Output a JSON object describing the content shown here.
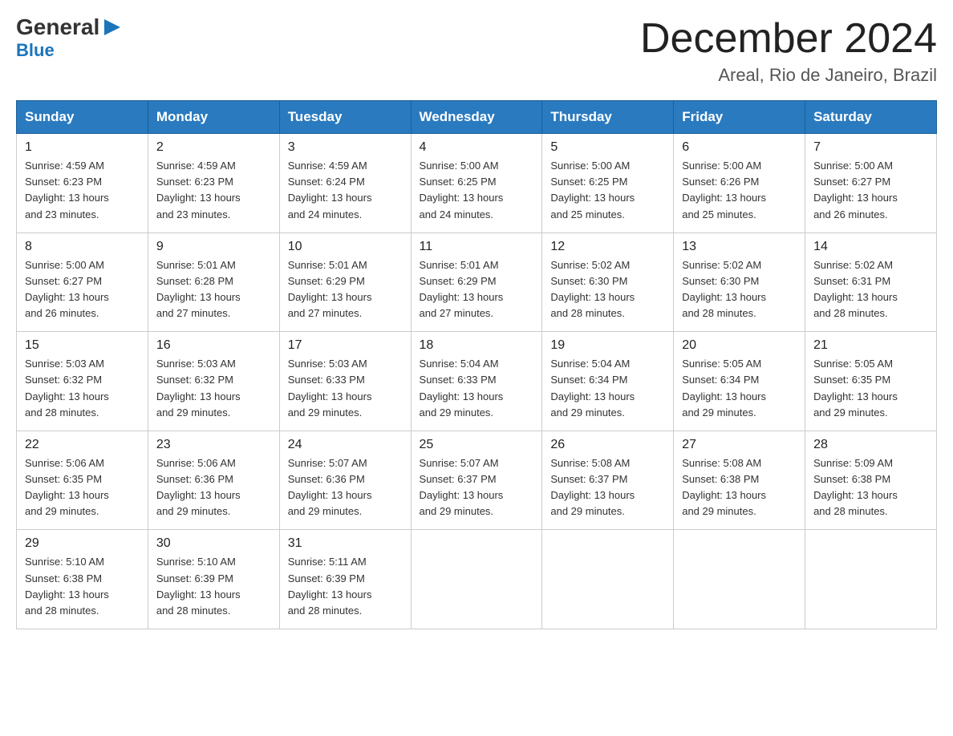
{
  "logo": {
    "general": "General",
    "blue": "Blue",
    "arrow": "▶"
  },
  "title": {
    "main": "December 2024",
    "subtitle": "Areal, Rio de Janeiro, Brazil"
  },
  "header": {
    "days": [
      "Sunday",
      "Monday",
      "Tuesday",
      "Wednesday",
      "Thursday",
      "Friday",
      "Saturday"
    ]
  },
  "weeks": [
    {
      "days": [
        {
          "num": "1",
          "sunrise": "4:59 AM",
          "sunset": "6:23 PM",
          "daylight": "13 hours and 23 minutes."
        },
        {
          "num": "2",
          "sunrise": "4:59 AM",
          "sunset": "6:23 PM",
          "daylight": "13 hours and 23 minutes."
        },
        {
          "num": "3",
          "sunrise": "4:59 AM",
          "sunset": "6:24 PM",
          "daylight": "13 hours and 24 minutes."
        },
        {
          "num": "4",
          "sunrise": "5:00 AM",
          "sunset": "6:25 PM",
          "daylight": "13 hours and 24 minutes."
        },
        {
          "num": "5",
          "sunrise": "5:00 AM",
          "sunset": "6:25 PM",
          "daylight": "13 hours and 25 minutes."
        },
        {
          "num": "6",
          "sunrise": "5:00 AM",
          "sunset": "6:26 PM",
          "daylight": "13 hours and 25 minutes."
        },
        {
          "num": "7",
          "sunrise": "5:00 AM",
          "sunset": "6:27 PM",
          "daylight": "13 hours and 26 minutes."
        }
      ]
    },
    {
      "days": [
        {
          "num": "8",
          "sunrise": "5:00 AM",
          "sunset": "6:27 PM",
          "daylight": "13 hours and 26 minutes."
        },
        {
          "num": "9",
          "sunrise": "5:01 AM",
          "sunset": "6:28 PM",
          "daylight": "13 hours and 27 minutes."
        },
        {
          "num": "10",
          "sunrise": "5:01 AM",
          "sunset": "6:29 PM",
          "daylight": "13 hours and 27 minutes."
        },
        {
          "num": "11",
          "sunrise": "5:01 AM",
          "sunset": "6:29 PM",
          "daylight": "13 hours and 27 minutes."
        },
        {
          "num": "12",
          "sunrise": "5:02 AM",
          "sunset": "6:30 PM",
          "daylight": "13 hours and 28 minutes."
        },
        {
          "num": "13",
          "sunrise": "5:02 AM",
          "sunset": "6:30 PM",
          "daylight": "13 hours and 28 minutes."
        },
        {
          "num": "14",
          "sunrise": "5:02 AM",
          "sunset": "6:31 PM",
          "daylight": "13 hours and 28 minutes."
        }
      ]
    },
    {
      "days": [
        {
          "num": "15",
          "sunrise": "5:03 AM",
          "sunset": "6:32 PM",
          "daylight": "13 hours and 28 minutes."
        },
        {
          "num": "16",
          "sunrise": "5:03 AM",
          "sunset": "6:32 PM",
          "daylight": "13 hours and 29 minutes."
        },
        {
          "num": "17",
          "sunrise": "5:03 AM",
          "sunset": "6:33 PM",
          "daylight": "13 hours and 29 minutes."
        },
        {
          "num": "18",
          "sunrise": "5:04 AM",
          "sunset": "6:33 PM",
          "daylight": "13 hours and 29 minutes."
        },
        {
          "num": "19",
          "sunrise": "5:04 AM",
          "sunset": "6:34 PM",
          "daylight": "13 hours and 29 minutes."
        },
        {
          "num": "20",
          "sunrise": "5:05 AM",
          "sunset": "6:34 PM",
          "daylight": "13 hours and 29 minutes."
        },
        {
          "num": "21",
          "sunrise": "5:05 AM",
          "sunset": "6:35 PM",
          "daylight": "13 hours and 29 minutes."
        }
      ]
    },
    {
      "days": [
        {
          "num": "22",
          "sunrise": "5:06 AM",
          "sunset": "6:35 PM",
          "daylight": "13 hours and 29 minutes."
        },
        {
          "num": "23",
          "sunrise": "5:06 AM",
          "sunset": "6:36 PM",
          "daylight": "13 hours and 29 minutes."
        },
        {
          "num": "24",
          "sunrise": "5:07 AM",
          "sunset": "6:36 PM",
          "daylight": "13 hours and 29 minutes."
        },
        {
          "num": "25",
          "sunrise": "5:07 AM",
          "sunset": "6:37 PM",
          "daylight": "13 hours and 29 minutes."
        },
        {
          "num": "26",
          "sunrise": "5:08 AM",
          "sunset": "6:37 PM",
          "daylight": "13 hours and 29 minutes."
        },
        {
          "num": "27",
          "sunrise": "5:08 AM",
          "sunset": "6:38 PM",
          "daylight": "13 hours and 29 minutes."
        },
        {
          "num": "28",
          "sunrise": "5:09 AM",
          "sunset": "6:38 PM",
          "daylight": "13 hours and 28 minutes."
        }
      ]
    },
    {
      "days": [
        {
          "num": "29",
          "sunrise": "5:10 AM",
          "sunset": "6:38 PM",
          "daylight": "13 hours and 28 minutes."
        },
        {
          "num": "30",
          "sunrise": "5:10 AM",
          "sunset": "6:39 PM",
          "daylight": "13 hours and 28 minutes."
        },
        {
          "num": "31",
          "sunrise": "5:11 AM",
          "sunset": "6:39 PM",
          "daylight": "13 hours and 28 minutes."
        },
        null,
        null,
        null,
        null
      ]
    }
  ],
  "labels": {
    "sunrise": "Sunrise:",
    "sunset": "Sunset:",
    "daylight": "Daylight:"
  }
}
